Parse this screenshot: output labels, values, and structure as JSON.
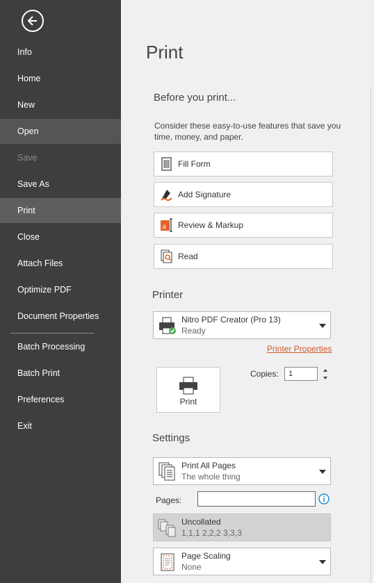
{
  "sidebar": {
    "items": [
      {
        "label": "Info"
      },
      {
        "label": "Home"
      },
      {
        "label": "New"
      },
      {
        "label": "Open"
      },
      {
        "label": "Save"
      },
      {
        "label": "Save As"
      },
      {
        "label": "Print"
      },
      {
        "label": "Close"
      },
      {
        "label": "Attach Files"
      },
      {
        "label": "Optimize PDF"
      },
      {
        "label": "Document Properties"
      },
      {
        "label": "Batch Processing"
      },
      {
        "label": "Batch Print"
      },
      {
        "label": "Preferences"
      },
      {
        "label": "Exit"
      }
    ],
    "colors": {
      "background": "#3e3e3e",
      "selected": "#5e5e5e",
      "disabled_text": "#8a8a8a"
    }
  },
  "main": {
    "title": "Print",
    "before": {
      "heading": "Before you print...",
      "description": "Consider these easy-to-use features that save you time, money, and paper.",
      "buttons": [
        {
          "label": "Fill Form",
          "icon": "fill-form-icon"
        },
        {
          "label": "Add Signature",
          "icon": "signature-pen-icon"
        },
        {
          "label": "Review & Markup",
          "icon": "review-markup-icon"
        },
        {
          "label": "Read",
          "icon": "read-icon"
        }
      ]
    },
    "printer": {
      "heading": "Printer",
      "name": "Nitro PDF Creator (Pro 13)",
      "status": "Ready",
      "properties_link": "Printer Properties",
      "print_button": "Print",
      "copies_label": "Copies:",
      "copies_value": "1"
    },
    "settings": {
      "heading": "Settings",
      "range": {
        "title": "Print All Pages",
        "subtitle": "The whole thing"
      },
      "pages_label": "Pages:",
      "pages_value": "",
      "collation": {
        "title": "Uncollated",
        "subtitle": "1,1,1   2,2,2   3,3,3"
      },
      "scaling": {
        "title": "Page Scaling",
        "subtitle": "None"
      }
    },
    "colors": {
      "link": "#d15a2b",
      "info": "#1a8fd1",
      "accent_orange": "#e2622a"
    }
  }
}
